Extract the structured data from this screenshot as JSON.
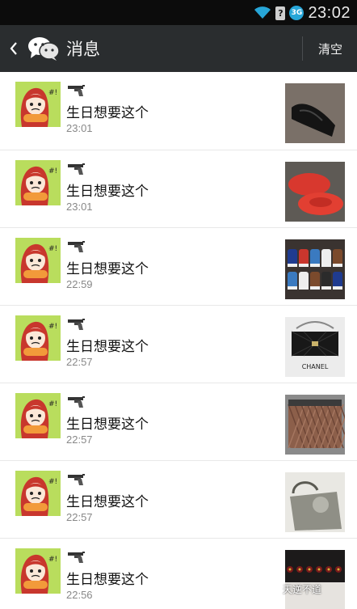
{
  "status_bar": {
    "time": "23:02",
    "sim_label": "?",
    "network_label": "3G",
    "icons": [
      "wifi-icon",
      "sim-icon",
      "network-icon"
    ]
  },
  "title_bar": {
    "title": "消息",
    "clear_label": "清空",
    "icons": [
      "back-icon",
      "wechat-icon"
    ]
  },
  "messages": [
    {
      "text": "生日想要这个",
      "time": "23:01",
      "thumb": "black-leather-shoe"
    },
    {
      "text": "生日想要这个",
      "time": "23:01",
      "thumb": "red-suede-loafers"
    },
    {
      "text": "生日想要这个",
      "time": "22:59",
      "thumb": "colorful-sneakers"
    },
    {
      "text": "生日想要这个",
      "time": "22:57",
      "thumb": "chanel-bag",
      "thumb_label": "CHANEL"
    },
    {
      "text": "生日想要这个",
      "time": "22:57",
      "thumb": "woven-leather-clutch"
    },
    {
      "text": "生日想要这个",
      "time": "22:57",
      "thumb": "grey-handbag"
    },
    {
      "text": "生日想要这个",
      "time": "22:56",
      "thumb": "clover-bracelet"
    }
  ],
  "watermark": "天逆不道",
  "colors": {
    "status_bg": "#0c0c0c",
    "title_bg": "#2a2d2f",
    "avatar_bg": "#b9dd5d",
    "divider": "#e8e8e8"
  }
}
